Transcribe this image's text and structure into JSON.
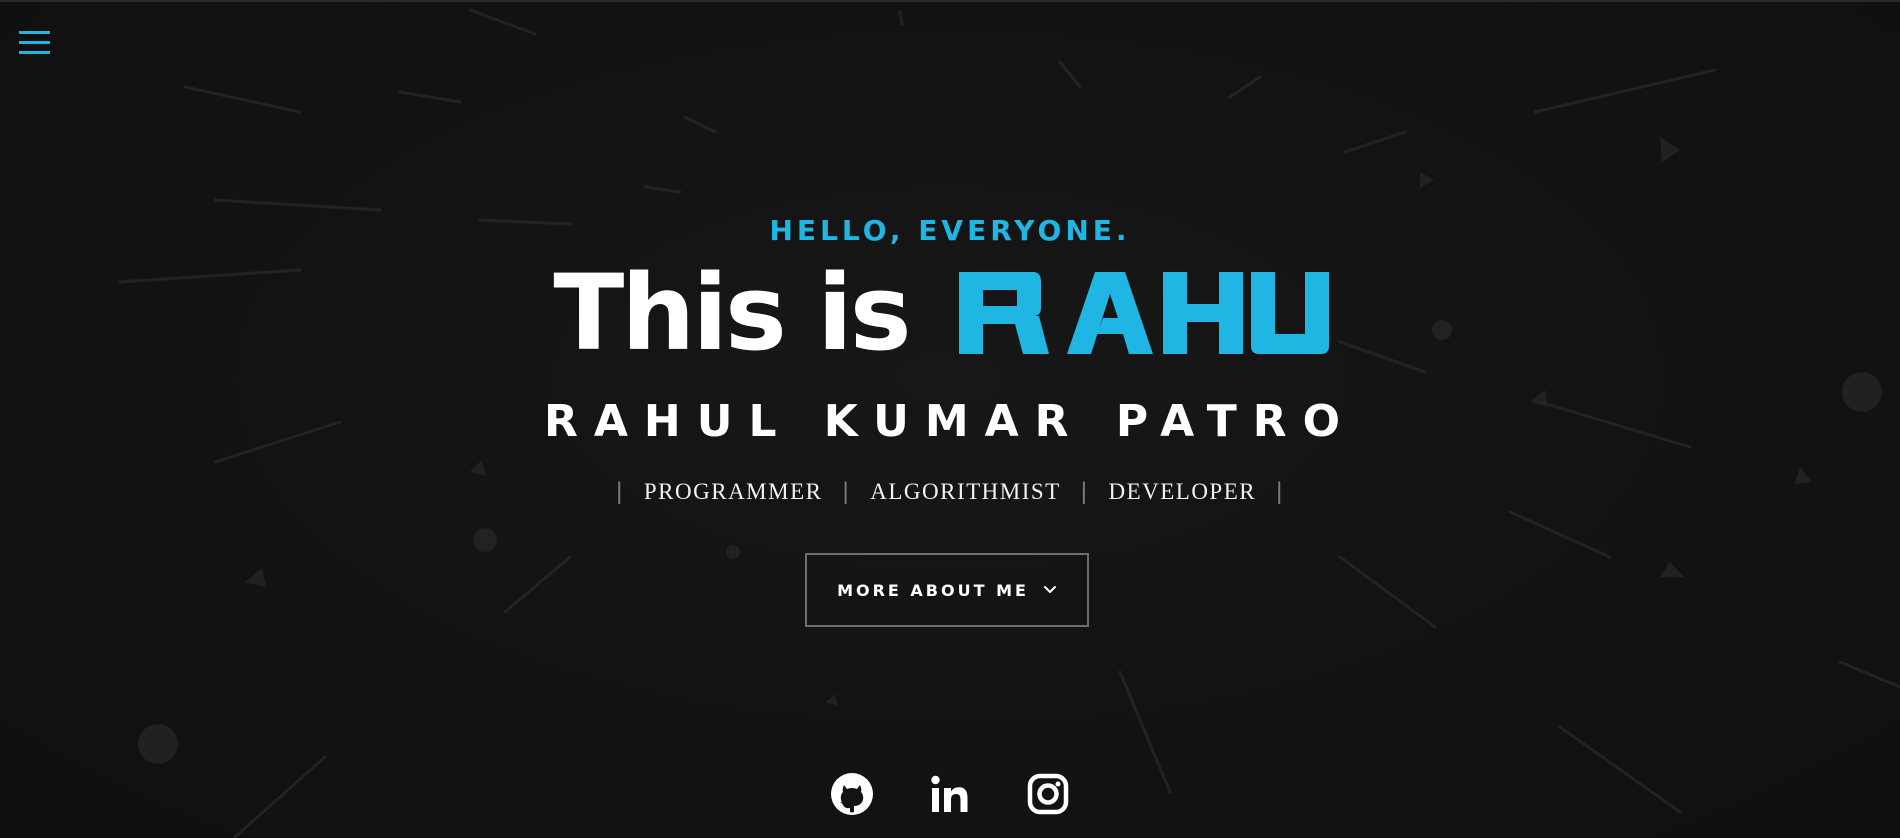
{
  "header": {
    "menu_icon": "hamburger-menu-icon",
    "accent_color": "#1fb6e3"
  },
  "hero": {
    "greeting": "HELLO, EVERYONE.",
    "intro_prefix": "This is",
    "logo_text": "RAHUL",
    "full_name": "RAHUL KUMAR PATRO",
    "roles": [
      "PROGRAMMER",
      "ALGORITHMIST",
      "DEVELOPER"
    ],
    "cta_label": "MORE ABOUT ME",
    "cta_icon": "chevron-down-icon"
  },
  "socials": [
    {
      "icon": "github-icon",
      "name": "GitHub"
    },
    {
      "icon": "linkedin-icon",
      "name": "LinkedIn"
    },
    {
      "icon": "instagram-icon",
      "name": "Instagram"
    }
  ],
  "colors": {
    "background": "#131313",
    "accent": "#1fb6e3",
    "text": "#ffffff",
    "button_border": "#6e6e6e"
  }
}
